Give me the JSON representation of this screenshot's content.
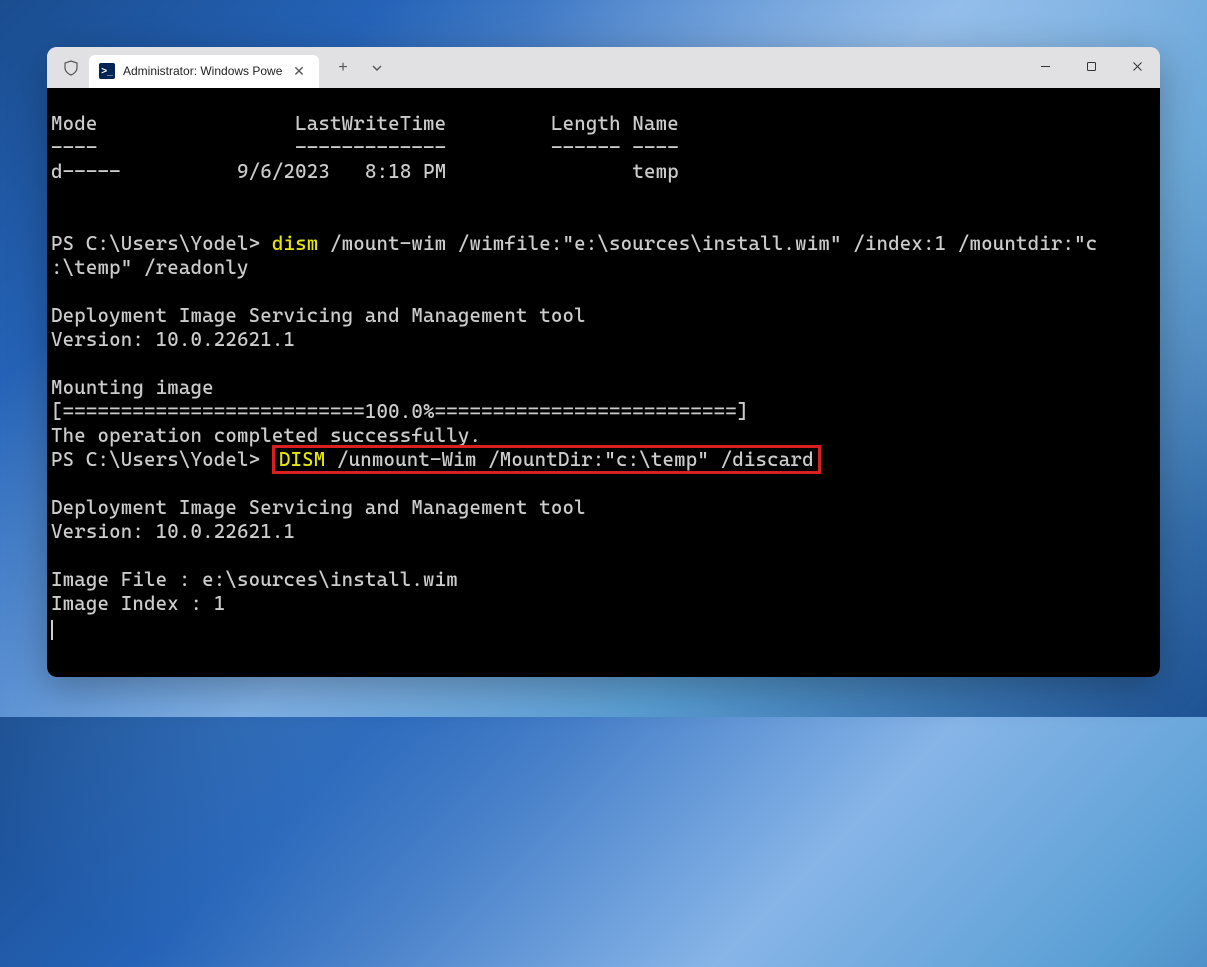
{
  "titlebar": {
    "tab_title": "Administrator: Windows Powe",
    "tab_icon_text": ">_"
  },
  "header": {
    "col1": "Mode",
    "col2": "LastWriteTime",
    "col3": "Length",
    "col4": "Name",
    "sep1": "----",
    "sep2": "-------------",
    "sep3": "------",
    "sep4": "----",
    "row1_mode": "d-----",
    "row1_date": "9/6/2023",
    "row1_time": "8:18 PM",
    "row1_name": "temp"
  },
  "block1": {
    "prompt": "PS C:\\Users\\Yodel> ",
    "cmd_name": "dism",
    "cmd_args_line1": " /mount-wim /wimfile:\"e:\\sources\\install.wim\" /index:1 /mountdir:\"c",
    "cmd_args_line2": ":\\temp\" /readonly",
    "tool_line": "Deployment Image Servicing and Management tool",
    "version_line": "Version: 10.0.22621.1",
    "mounting_line": "Mounting image",
    "progress_line": "[==========================100.0%==========================]",
    "success_line": "The operation completed successfully."
  },
  "block2": {
    "prompt": "PS C:\\Users\\Yodel> ",
    "cmd_name": "DISM",
    "cmd_args": " /unmount-Wim /MountDir:\"c:\\temp\" /discard",
    "tool_line": "Deployment Image Servicing and Management tool",
    "version_line": "Version: 10.0.22621.1",
    "file_line": "Image File : e:\\sources\\install.wim",
    "index_line": "Image Index : 1"
  }
}
